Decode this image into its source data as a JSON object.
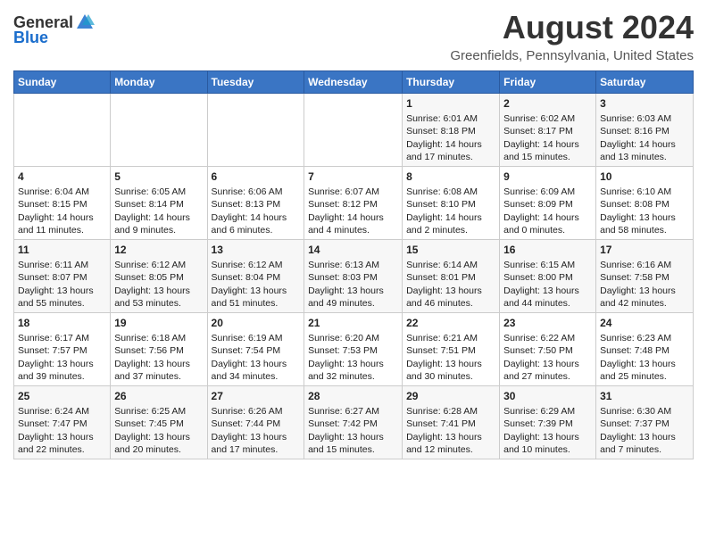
{
  "logo": {
    "general": "General",
    "blue": "Blue"
  },
  "title": "August 2024",
  "location": "Greenfields, Pennsylvania, United States",
  "days_of_week": [
    "Sunday",
    "Monday",
    "Tuesday",
    "Wednesday",
    "Thursday",
    "Friday",
    "Saturday"
  ],
  "weeks": [
    [
      {
        "day": "",
        "content": ""
      },
      {
        "day": "",
        "content": ""
      },
      {
        "day": "",
        "content": ""
      },
      {
        "day": "",
        "content": ""
      },
      {
        "day": "1",
        "content": "Sunrise: 6:01 AM\nSunset: 8:18 PM\nDaylight: 14 hours\nand 17 minutes."
      },
      {
        "day": "2",
        "content": "Sunrise: 6:02 AM\nSunset: 8:17 PM\nDaylight: 14 hours\nand 15 minutes."
      },
      {
        "day": "3",
        "content": "Sunrise: 6:03 AM\nSunset: 8:16 PM\nDaylight: 14 hours\nand 13 minutes."
      }
    ],
    [
      {
        "day": "4",
        "content": "Sunrise: 6:04 AM\nSunset: 8:15 PM\nDaylight: 14 hours\nand 11 minutes."
      },
      {
        "day": "5",
        "content": "Sunrise: 6:05 AM\nSunset: 8:14 PM\nDaylight: 14 hours\nand 9 minutes."
      },
      {
        "day": "6",
        "content": "Sunrise: 6:06 AM\nSunset: 8:13 PM\nDaylight: 14 hours\nand 6 minutes."
      },
      {
        "day": "7",
        "content": "Sunrise: 6:07 AM\nSunset: 8:12 PM\nDaylight: 14 hours\nand 4 minutes."
      },
      {
        "day": "8",
        "content": "Sunrise: 6:08 AM\nSunset: 8:10 PM\nDaylight: 14 hours\nand 2 minutes."
      },
      {
        "day": "9",
        "content": "Sunrise: 6:09 AM\nSunset: 8:09 PM\nDaylight: 14 hours\nand 0 minutes."
      },
      {
        "day": "10",
        "content": "Sunrise: 6:10 AM\nSunset: 8:08 PM\nDaylight: 13 hours\nand 58 minutes."
      }
    ],
    [
      {
        "day": "11",
        "content": "Sunrise: 6:11 AM\nSunset: 8:07 PM\nDaylight: 13 hours\nand 55 minutes."
      },
      {
        "day": "12",
        "content": "Sunrise: 6:12 AM\nSunset: 8:05 PM\nDaylight: 13 hours\nand 53 minutes."
      },
      {
        "day": "13",
        "content": "Sunrise: 6:12 AM\nSunset: 8:04 PM\nDaylight: 13 hours\nand 51 minutes."
      },
      {
        "day": "14",
        "content": "Sunrise: 6:13 AM\nSunset: 8:03 PM\nDaylight: 13 hours\nand 49 minutes."
      },
      {
        "day": "15",
        "content": "Sunrise: 6:14 AM\nSunset: 8:01 PM\nDaylight: 13 hours\nand 46 minutes."
      },
      {
        "day": "16",
        "content": "Sunrise: 6:15 AM\nSunset: 8:00 PM\nDaylight: 13 hours\nand 44 minutes."
      },
      {
        "day": "17",
        "content": "Sunrise: 6:16 AM\nSunset: 7:58 PM\nDaylight: 13 hours\nand 42 minutes."
      }
    ],
    [
      {
        "day": "18",
        "content": "Sunrise: 6:17 AM\nSunset: 7:57 PM\nDaylight: 13 hours\nand 39 minutes."
      },
      {
        "day": "19",
        "content": "Sunrise: 6:18 AM\nSunset: 7:56 PM\nDaylight: 13 hours\nand 37 minutes."
      },
      {
        "day": "20",
        "content": "Sunrise: 6:19 AM\nSunset: 7:54 PM\nDaylight: 13 hours\nand 34 minutes."
      },
      {
        "day": "21",
        "content": "Sunrise: 6:20 AM\nSunset: 7:53 PM\nDaylight: 13 hours\nand 32 minutes."
      },
      {
        "day": "22",
        "content": "Sunrise: 6:21 AM\nSunset: 7:51 PM\nDaylight: 13 hours\nand 30 minutes."
      },
      {
        "day": "23",
        "content": "Sunrise: 6:22 AM\nSunset: 7:50 PM\nDaylight: 13 hours\nand 27 minutes."
      },
      {
        "day": "24",
        "content": "Sunrise: 6:23 AM\nSunset: 7:48 PM\nDaylight: 13 hours\nand 25 minutes."
      }
    ],
    [
      {
        "day": "25",
        "content": "Sunrise: 6:24 AM\nSunset: 7:47 PM\nDaylight: 13 hours\nand 22 minutes."
      },
      {
        "day": "26",
        "content": "Sunrise: 6:25 AM\nSunset: 7:45 PM\nDaylight: 13 hours\nand 20 minutes."
      },
      {
        "day": "27",
        "content": "Sunrise: 6:26 AM\nSunset: 7:44 PM\nDaylight: 13 hours\nand 17 minutes."
      },
      {
        "day": "28",
        "content": "Sunrise: 6:27 AM\nSunset: 7:42 PM\nDaylight: 13 hours\nand 15 minutes."
      },
      {
        "day": "29",
        "content": "Sunrise: 6:28 AM\nSunset: 7:41 PM\nDaylight: 13 hours\nand 12 minutes."
      },
      {
        "day": "30",
        "content": "Sunrise: 6:29 AM\nSunset: 7:39 PM\nDaylight: 13 hours\nand 10 minutes."
      },
      {
        "day": "31",
        "content": "Sunrise: 6:30 AM\nSunset: 7:37 PM\nDaylight: 13 hours\nand 7 minutes."
      }
    ]
  ]
}
